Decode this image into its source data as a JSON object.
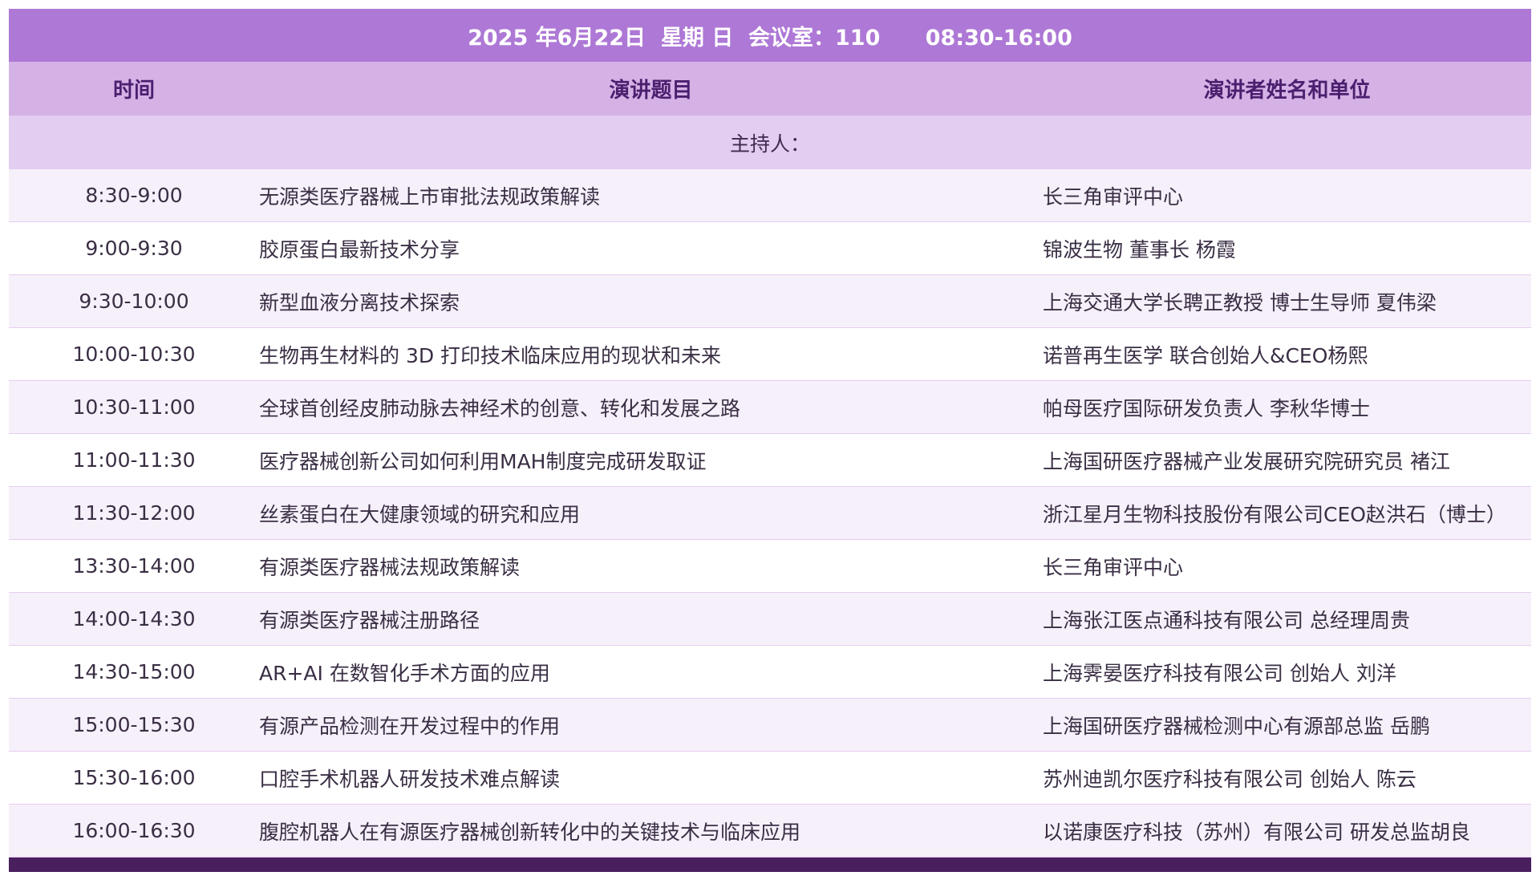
{
  "title": "2025 年6月22日  星期 日  会议室：110      08:30-16:00",
  "columns": {
    "time": "时间",
    "topic": "演讲题目",
    "speaker": "演讲者姓名和单位"
  },
  "host_label": "主持人：",
  "rows": [
    {
      "time": "8:30-9:00",
      "topic": "无源类医疗器械上市审批法规政策解读",
      "speaker": "长三角审评中心"
    },
    {
      "time": "9:00-9:30",
      "topic": "胶原蛋白最新技术分享",
      "speaker": "锦波生物 董事长 杨霞"
    },
    {
      "time": "9:30-10:00",
      "topic": "新型血液分离技术探索",
      "speaker": "上海交通大学长聘正教授 博士生导师 夏伟梁"
    },
    {
      "time": "10:00-10:30",
      "topic": "生物再生材料的 3D 打印技术临床应用的现状和未来",
      "speaker": "诺普再生医学 联合创始人&CEO杨熙"
    },
    {
      "time": "10:30-11:00",
      "topic": "全球首创经皮肺动脉去神经术的创意、转化和发展之路",
      "speaker": "帕母医疗国际研发负责人 李秋华博士"
    },
    {
      "time": "11:00-11:30",
      "topic": "医疗器械创新公司如何利用MAH制度完成研发取证",
      "speaker": "上海国研医疗器械产业发展研究院研究员 褚江"
    },
    {
      "time": "11:30-12:00",
      "topic": "丝素蛋白在大健康领域的研究和应用",
      "speaker": "浙江星月生物科技股份有限公司CEO赵洪石（博士）"
    },
    {
      "time": "13:30-14:00",
      "topic": "有源类医疗器械法规政策解读",
      "speaker": "长三角审评中心"
    },
    {
      "time": "14:00-14:30",
      "topic": "有源类医疗器械注册路径",
      "speaker": "上海张江医点通科技有限公司 总经理周贵"
    },
    {
      "time": "14:30-15:00",
      "topic": "AR+AI 在数智化手术方面的应用",
      "speaker": "上海霁晏医疗科技有限公司 创始人 刘洋"
    },
    {
      "time": "15:00-15:30",
      "topic": "有源产品检测在开发过程中的作用",
      "speaker": "上海国研医疗器械检测中心有源部总监 岳鹏"
    },
    {
      "time": "15:30-16:00",
      "topic": "口腔手术机器人研发技术难点解读",
      "speaker": "苏州迪凯尔医疗科技有限公司 创始人 陈云"
    },
    {
      "time": "16:00-16:30",
      "topic": "腹腔机器人在有源医疗器械创新转化中的关键技术与临床应用",
      "speaker": "以诺康医疗科技（苏州）有限公司 研发总监胡良"
    }
  ]
}
